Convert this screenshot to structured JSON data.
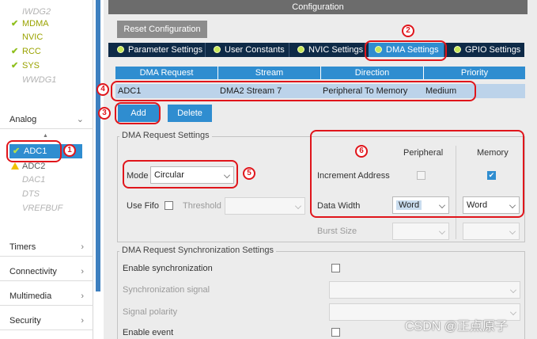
{
  "sidebar": {
    "items_top": [
      {
        "label": "IWDG2",
        "state": "muted"
      },
      {
        "label": "MDMA",
        "state": "ok"
      },
      {
        "label": "NVIC",
        "state": "plain"
      },
      {
        "label": "RCC",
        "state": "ok"
      },
      {
        "label": "SYS",
        "state": "ok"
      },
      {
        "label": "WWDG1",
        "state": "muted"
      }
    ],
    "category_analog": "Analog",
    "analog_items": [
      {
        "label": "ADC1",
        "state": "selected"
      },
      {
        "label": "ADC2",
        "state": "warning"
      },
      {
        "label": "DAC1",
        "state": "muted"
      },
      {
        "label": "DTS",
        "state": "muted"
      },
      {
        "label": "VREFBUF",
        "state": "muted"
      }
    ],
    "categories": [
      {
        "label": "Timers"
      },
      {
        "label": "Connectivity"
      },
      {
        "label": "Multimedia"
      },
      {
        "label": "Security"
      }
    ]
  },
  "config": {
    "title": "Configuration",
    "reset_label": "Reset Configuration",
    "tabs": [
      {
        "label": "Parameter Settings"
      },
      {
        "label": "User Constants"
      },
      {
        "label": "NVIC Settings"
      },
      {
        "label": "DMA Settings",
        "active": true
      },
      {
        "label": "GPIO Settings"
      }
    ]
  },
  "dma_table": {
    "headers": [
      "DMA Request",
      "Stream",
      "Direction",
      "Priority"
    ],
    "rows": [
      {
        "request": "ADC1",
        "stream": "DMA2 Stream 7",
        "direction": "Peripheral To Memory",
        "priority": "Medium"
      }
    ]
  },
  "buttons": {
    "add": "Add",
    "delete": "Delete"
  },
  "request_settings": {
    "title": "DMA Request Settings",
    "mode_label": "Mode",
    "mode_value": "Circular",
    "use_fifo_label": "Use Fifo",
    "threshold_label": "Threshold",
    "peripheral_header": "Peripheral",
    "memory_header": "Memory",
    "increment_label": "Increment Address",
    "increment_peripheral": false,
    "increment_memory": true,
    "data_width_label": "Data Width",
    "data_width_peripheral": "Word",
    "data_width_memory": "Word",
    "burst_size_label": "Burst Size"
  },
  "sync_settings": {
    "title": "DMA Request Synchronization Settings",
    "enable_sync_label": "Enable synchronization",
    "sync_signal_label": "Synchronization signal",
    "signal_polarity_label": "Signal polarity",
    "enable_event_label": "Enable event"
  },
  "annotations": [
    "1",
    "2",
    "3",
    "4",
    "5",
    "6"
  ],
  "watermark": "CSDN @正点原子",
  "colors": {
    "accent": "#2f8dd0",
    "tab_bar": "#0e2a47",
    "annotation": "#e0151b",
    "ok": "#9aa300"
  }
}
